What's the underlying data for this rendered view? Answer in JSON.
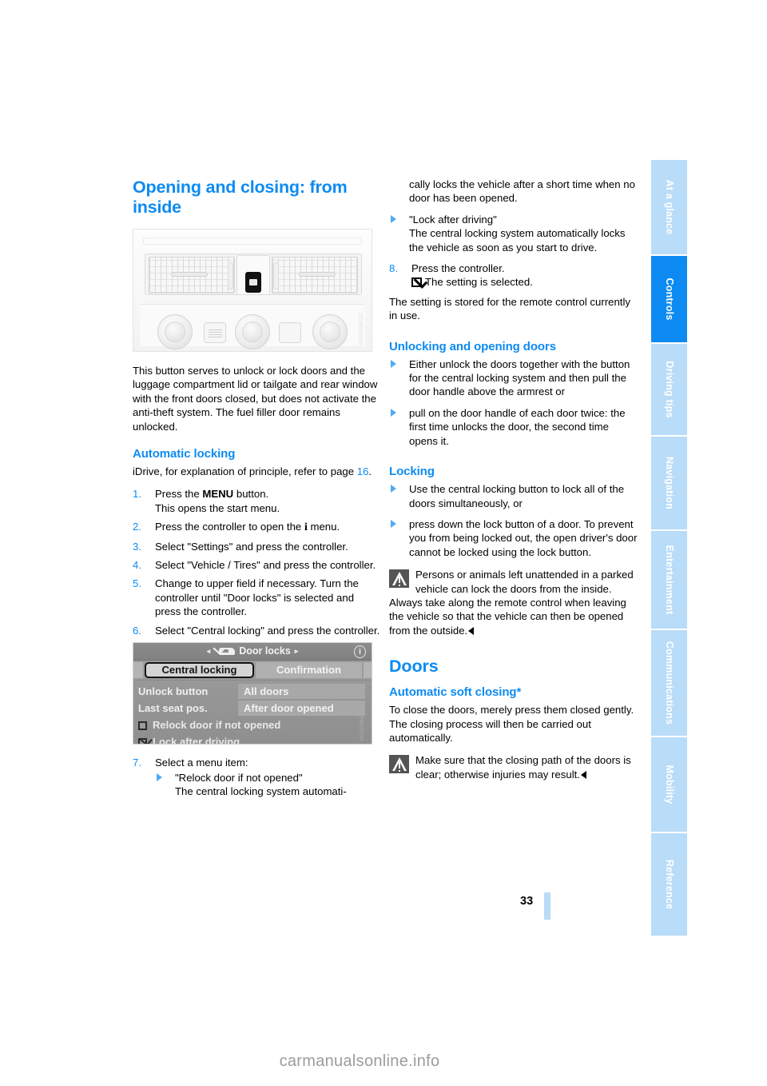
{
  "page": {
    "number": "33",
    "footer_watermark": "carmanualsonline.info"
  },
  "thumb_index": {
    "items": [
      {
        "label": "At a glance",
        "active": false
      },
      {
        "label": "Controls",
        "active": true
      },
      {
        "label": "Driving tips",
        "active": false
      },
      {
        "label": "Navigation",
        "active": false
      },
      {
        "label": "Entertainment",
        "active": false
      },
      {
        "label": "Communications",
        "active": false
      },
      {
        "label": "Mobility",
        "active": false
      },
      {
        "label": "Reference",
        "active": false
      }
    ],
    "active_color": "#0d8bf2",
    "inactive_color": "#b9dcf8"
  },
  "left_column": {
    "title": "Opening and closing: from inside",
    "figure_dashboard": {
      "name": "center-console-with-central-locking-button",
      "code": "VE0020BEDZ"
    },
    "intro": "This button serves to unlock or lock doors and the luggage compartment lid or tailgate and rear window with the front doors closed, but does not activate the anti-theft system. The fuel filler door remains unlocked.",
    "automatic_locking": {
      "heading": "Automatic locking",
      "intro_before_page": "iDrive, for explanation of principle, refer to page ",
      "page_ref": "16",
      "intro_after_page": ".",
      "steps": [
        {
          "num": "1.",
          "text_before": "Press the ",
          "emphasis": "MENU",
          "text_after": " button.",
          "sub": "This opens the start menu."
        },
        {
          "num": "2.",
          "text_before": "Press the controller to open the ",
          "emphasis": "i",
          "text_after": " menu.",
          "sub": ""
        },
        {
          "num": "3.",
          "text_before": "Select \"Settings\" and press the controller.",
          "emphasis": "",
          "text_after": "",
          "sub": ""
        },
        {
          "num": "4.",
          "text_before": "Select \"Vehicle / Tires\" and press the controller.",
          "emphasis": "",
          "text_after": "",
          "sub": ""
        },
        {
          "num": "5.",
          "text_before": "Change to upper field if necessary. Turn the controller until \"Door locks\" is selected and press the controller.",
          "emphasis": "",
          "text_after": "",
          "sub": ""
        },
        {
          "num": "6.",
          "text_before": "Select \"Central locking\" and press the controller.",
          "emphasis": "",
          "text_after": "",
          "sub": ""
        }
      ]
    },
    "figure_idrive": {
      "title": "Door locks",
      "arrow_left": "◂",
      "arrow_right": "▸",
      "help_glyph": "i",
      "tabs": [
        {
          "label": "Central locking",
          "selected": true
        },
        {
          "label": "Confirmation",
          "selected": false
        }
      ],
      "rows": [
        {
          "label": "Unlock button",
          "value": "All doors"
        },
        {
          "label": "Last seat pos.",
          "value": "After door opened"
        }
      ],
      "checkboxes": [
        {
          "label": "Relock door if not opened",
          "checked": false
        },
        {
          "label": "Lock after driving",
          "checked": true
        }
      ],
      "code": "VE0020BEDZ"
    },
    "step7": {
      "num": "7.",
      "text": "Select a menu item:",
      "bullets": [
        {
          "title": "\"Relock door if not opened\"",
          "body": "The central locking system automati-"
        }
      ]
    }
  },
  "right_column": {
    "continued_from_left": "cally locks the vehicle after a short time when no door has been opened.",
    "bullet_lock_after_driving": {
      "title": "\"Lock after driving\"",
      "body": "The central locking system automatically locks the vehicle as soon as you start to drive."
    },
    "step8": {
      "num": "8.",
      "text": "Press the controller.",
      "sub_icon": "checked-checkbox-icon",
      "sub": "The setting is selected."
    },
    "stored_note": "The setting is stored for the remote control currently in use.",
    "unlocking_section": {
      "heading": "Unlocking and opening doors",
      "bullets": [
        "Either unlock the doors together with the button for the central locking system and then pull the door handle above the armrest or",
        "pull on the door handle of each door twice: the first time unlocks the door, the second time opens it."
      ]
    },
    "locking_section": {
      "heading": "Locking",
      "bullets": [
        "Use the central locking button to lock all of the doors simultaneously, or",
        "press down the lock button of a door. To prevent you from being locked out, the open driver's door cannot be locked using the lock button."
      ],
      "warning": {
        "icon": "warning-triangle-icon",
        "text": "Persons or animals left unattended in a parked vehicle can lock the doors from the inside. Always take along the remote control when leaving the vehicle so that the vehicle can then be opened from the outside."
      }
    },
    "doors_section": {
      "heading": "Doors",
      "sub_heading": "Automatic soft closing*",
      "body": "To close the doors, merely press them closed gently. The closing process will then be carried out automatically.",
      "warning": {
        "icon": "warning-triangle-icon",
        "text": "Make sure that the closing path of the doors is clear; otherwise injuries may result."
      }
    }
  }
}
